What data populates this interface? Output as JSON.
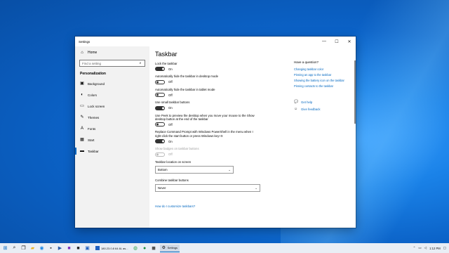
{
  "window": {
    "title": "Settings",
    "controls": {
      "minimize": "—",
      "maximize": "☐",
      "close": "✕"
    }
  },
  "sidebar": {
    "home": "Home",
    "search_placeholder": "Find a setting",
    "section": "Personalization",
    "items": [
      {
        "label": "Background",
        "icon": "image-icon",
        "glyph": "▣"
      },
      {
        "label": "Colors",
        "icon": "palette-icon",
        "glyph": "◐"
      },
      {
        "label": "Lock screen",
        "icon": "lock-screen-icon",
        "glyph": "▭"
      },
      {
        "label": "Themes",
        "icon": "brush-icon",
        "glyph": "✎"
      },
      {
        "label": "Fonts",
        "icon": "font-icon",
        "glyph": "A"
      },
      {
        "label": "Start",
        "icon": "start-icon",
        "glyph": "▦"
      },
      {
        "label": "Taskbar",
        "icon": "taskbar-icon",
        "glyph": "▬"
      }
    ],
    "active_item": "Taskbar"
  },
  "main": {
    "title": "Taskbar",
    "settings": [
      {
        "label": "Lock the taskbar",
        "state": "On",
        "on": true,
        "disabled": false
      },
      {
        "label": "Automatically hide the taskbar in desktop mode",
        "state": "Off",
        "on": false,
        "disabled": false
      },
      {
        "label": "Automatically hide the taskbar in tablet mode",
        "state": "Off",
        "on": false,
        "disabled": false
      },
      {
        "label": "Use small taskbar buttons",
        "state": "On",
        "on": true,
        "disabled": false
      },
      {
        "label": "Use Peek to preview the desktop when you move your mouse to the Show desktop button at the end of the taskbar",
        "state": "Off",
        "on": false,
        "disabled": false
      },
      {
        "label": "Replace Command Prompt with Windows PowerShell in the menu when I right-click the start button or press Windows key+X",
        "state": "On",
        "on": true,
        "disabled": false
      },
      {
        "label": "Show badges on taskbar buttons",
        "state": "Off",
        "on": false,
        "disabled": true
      }
    ],
    "location_label": "Taskbar location on screen",
    "location_value": "Bottom",
    "combine_label": "Combine taskbar buttons",
    "combine_value": "Never",
    "help_link": "How do I customize taskbars?"
  },
  "right_panel": {
    "title": "Have a question?",
    "links": [
      "Changing taskbar color",
      "Pinning an app to the taskbar",
      "Showing the battery icon on the taskbar",
      "Pinning contacts to the taskbar"
    ],
    "get_help": "Get help",
    "give_feedback": "Give feedback"
  },
  "taskbar": {
    "settings_app": "Settings",
    "vm_app": "180.23.0.8 64.6L as...",
    "clock": "1:12 PM"
  },
  "colors": {
    "accent": "#0067c0",
    "desktop": "#0b62c7"
  }
}
